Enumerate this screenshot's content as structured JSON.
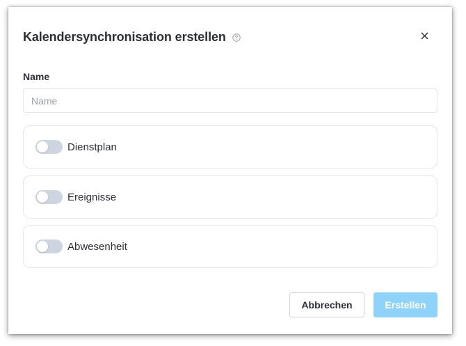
{
  "dialog": {
    "title": "Kalendersynchronisation erstellen",
    "help_icon": "question-circle-icon",
    "close_icon": "close-x-icon"
  },
  "name_field": {
    "label": "Name",
    "value": "",
    "placeholder": "Name"
  },
  "sync_options": [
    {
      "label": "Dienstplan",
      "enabled": false
    },
    {
      "label": "Ereignisse",
      "enabled": false
    },
    {
      "label": "Abwesenheit",
      "enabled": false
    }
  ],
  "footer": {
    "cancel_label": "Abbrechen",
    "create_label": "Erstellen"
  },
  "colors": {
    "primary_disabled": "#8fd3fb",
    "toggle_off": "#cdd6e0",
    "text": "#2b2f36",
    "border": "#e3e6ea"
  }
}
